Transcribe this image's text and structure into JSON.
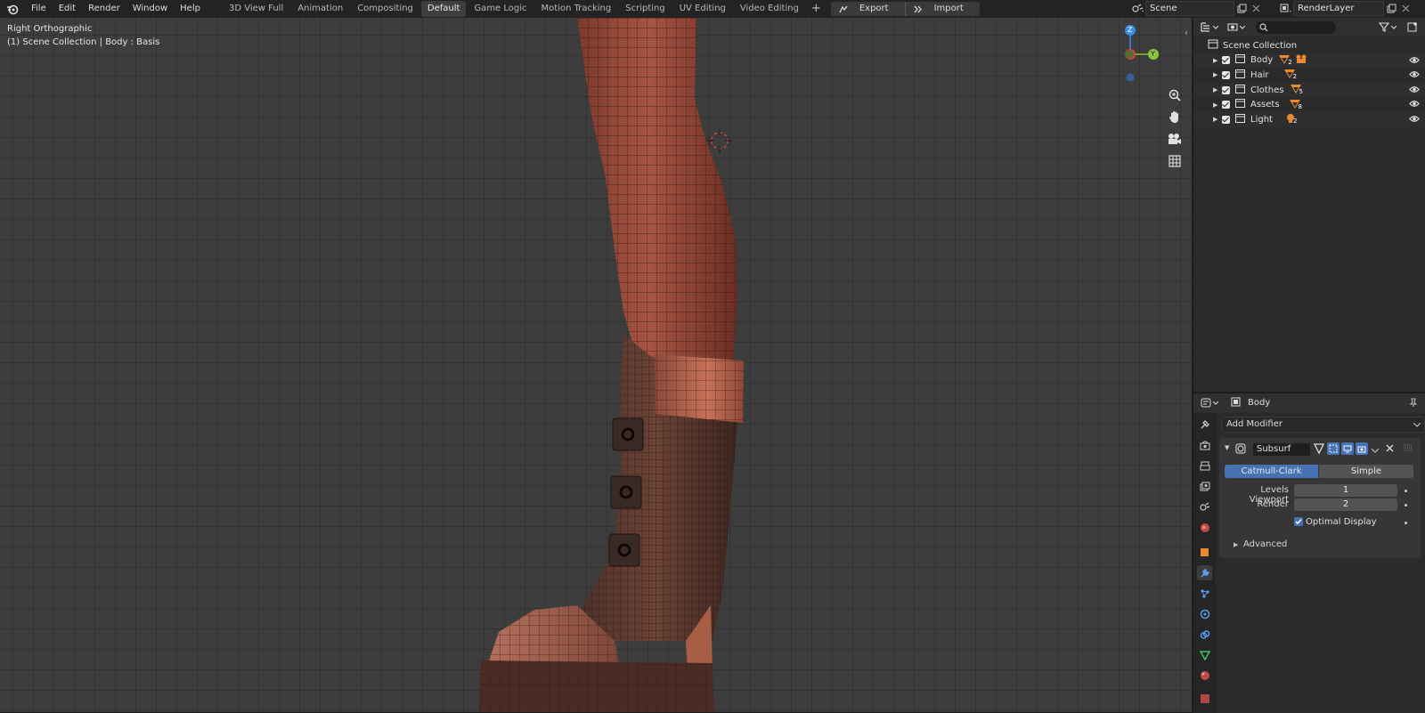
{
  "menu": {
    "items": [
      "File",
      "Edit",
      "Render",
      "Window",
      "Help"
    ]
  },
  "workspaces": {
    "tabs": [
      "3D View Full",
      "Animation",
      "Compositing",
      "Default",
      "Game Logic",
      "Motion Tracking",
      "Scripting",
      "UV Editing",
      "Video Editing"
    ],
    "active": "Default",
    "add_label": "+"
  },
  "io": {
    "export_label": "Export",
    "import_label": "Import"
  },
  "scene": {
    "name": "Scene"
  },
  "render_layer": {
    "name": "RenderLayer"
  },
  "viewport": {
    "view_name": "Right Orthographic",
    "context_line": "(1) Scene Collection | Body : Basis",
    "gizmo": {
      "z": "Z",
      "x": "X",
      "y": "Y"
    }
  },
  "outliner": {
    "root": "Scene Collection",
    "collections": [
      {
        "name": "Body",
        "count": "2"
      },
      {
        "name": "Hair",
        "count": "2"
      },
      {
        "name": "Clothes",
        "count": "5"
      },
      {
        "name": "Assets",
        "count": "8"
      },
      {
        "name": "Light",
        "count": "2"
      }
    ]
  },
  "properties": {
    "object_name": "Body",
    "add_modifier_label": "Add Modifier",
    "modifier": {
      "name": "Subsurf",
      "algorithms": [
        "Catmull-Clark",
        "Simple"
      ],
      "active_algorithm": "Catmull-Clark",
      "levels_viewport_label": "Levels Viewport",
      "levels_viewport": "1",
      "render_label": "Render",
      "render": "2",
      "optimal_display_label": "Optimal Display",
      "optimal_display": true,
      "advanced_label": "Advanced"
    }
  },
  "colors": {
    "accent": "#4772b3",
    "viewport_bg": "#3d3d3d",
    "panel_bg": "#2b2b2b",
    "collection_orange": "#e88a2d",
    "axis_x": "#e83a4e",
    "axis_y": "#8cc63e",
    "axis_z": "#3b8ee8"
  }
}
